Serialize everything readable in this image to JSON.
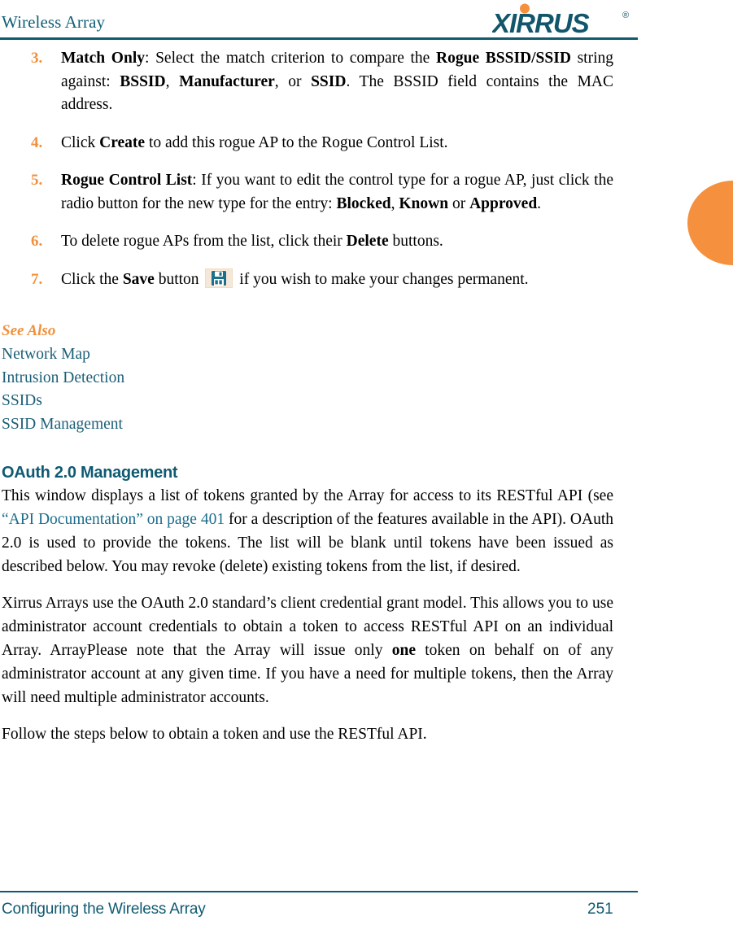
{
  "header": {
    "title": "Wireless Array",
    "logo_text": "XIRRUS",
    "logo_trademark": "®",
    "logo_color": "#12566b",
    "logo_dot_color": "#f5913e"
  },
  "edge_tab": {
    "color": "#f5913e"
  },
  "steps": [
    {
      "num": "3.",
      "parts": [
        {
          "t": "Match Only",
          "b": true
        },
        {
          "t": ": Select the match criterion to compare the ",
          "b": false
        },
        {
          "t": "Rogue BSSID/SSID",
          "b": true
        },
        {
          "t": " string against: ",
          "b": false
        },
        {
          "t": "BSSID",
          "b": true
        },
        {
          "t": ", ",
          "b": false
        },
        {
          "t": "Manufacturer",
          "b": true
        },
        {
          "t": ", or ",
          "b": false
        },
        {
          "t": "SSID",
          "b": true
        },
        {
          "t": ". The BSSID field contains the MAC address.",
          "b": false
        }
      ]
    },
    {
      "num": "4.",
      "parts": [
        {
          "t": "Click ",
          "b": false
        },
        {
          "t": "Create",
          "b": true
        },
        {
          "t": " to add this rogue AP to the Rogue Control List.",
          "b": false
        }
      ]
    },
    {
      "num": "5.",
      "parts": [
        {
          "t": "Rogue Control List",
          "b": true
        },
        {
          "t": ": If you want to edit the control type for a rogue AP, just click the radio button for the new type for the entry: ",
          "b": false
        },
        {
          "t": "Blocked",
          "b": true
        },
        {
          "t": ", ",
          "b": false
        },
        {
          "t": "Known",
          "b": true
        },
        {
          "t": " or ",
          "b": false
        },
        {
          "t": "Approved",
          "b": true
        },
        {
          "t": ".",
          "b": false
        }
      ]
    },
    {
      "num": "6.",
      "parts": [
        {
          "t": "To delete rogue APs from the list, click their ",
          "b": false
        },
        {
          "t": "Delete",
          "b": true
        },
        {
          "t": " buttons.",
          "b": false
        }
      ]
    },
    {
      "num": "7.",
      "parts": [
        {
          "t": "Click the ",
          "b": false
        },
        {
          "t": "Save",
          "b": true
        },
        {
          "t": " button ",
          "b": false
        },
        {
          "icon": "save-floppy-icon"
        },
        {
          "t": " if you wish to make your changes permanent.",
          "b": false
        }
      ]
    }
  ],
  "see_also": {
    "title": "See Also",
    "links": [
      "Network Map",
      "Intrusion Detection",
      "SSIDs",
      "SSID Management"
    ]
  },
  "section": {
    "heading": "OAuth 2.0 Management",
    "paragraphs": [
      {
        "parts": [
          {
            "t": "This window displays a list of tokens granted by the Array for access to its RESTful API (see ",
            "style": "normal"
          },
          {
            "t": "“API Documentation” on page 401",
            "style": "xref"
          },
          {
            "t": " for a description of the features available in the API). OAuth 2.0 is used to provide the tokens. The list will be blank until tokens have been issued as described below. You may revoke (delete) existing tokens from the list, if desired.",
            "style": "normal"
          }
        ]
      },
      {
        "parts": [
          {
            "t": "Xirrus Arrays use the OAuth 2.0 standard’s client credential grant model. This allows you to use administrator account credentials to obtain a token to access RESTful API on an individual Array. ArrayPlease note that the Array will issue only ",
            "style": "normal"
          },
          {
            "t": "one",
            "style": "bold"
          },
          {
            "t": " token on behalf on of any administrator account at any given time. If you have a need for multiple tokens, then the Array will need multiple administrator accounts.",
            "style": "normal"
          }
        ]
      },
      {
        "parts": [
          {
            "t": "Follow the steps below to obtain a token and use the RESTful API.",
            "style": "normal"
          }
        ]
      }
    ]
  },
  "footer": {
    "left": "Configuring the Wireless Array",
    "page_number": "251"
  }
}
